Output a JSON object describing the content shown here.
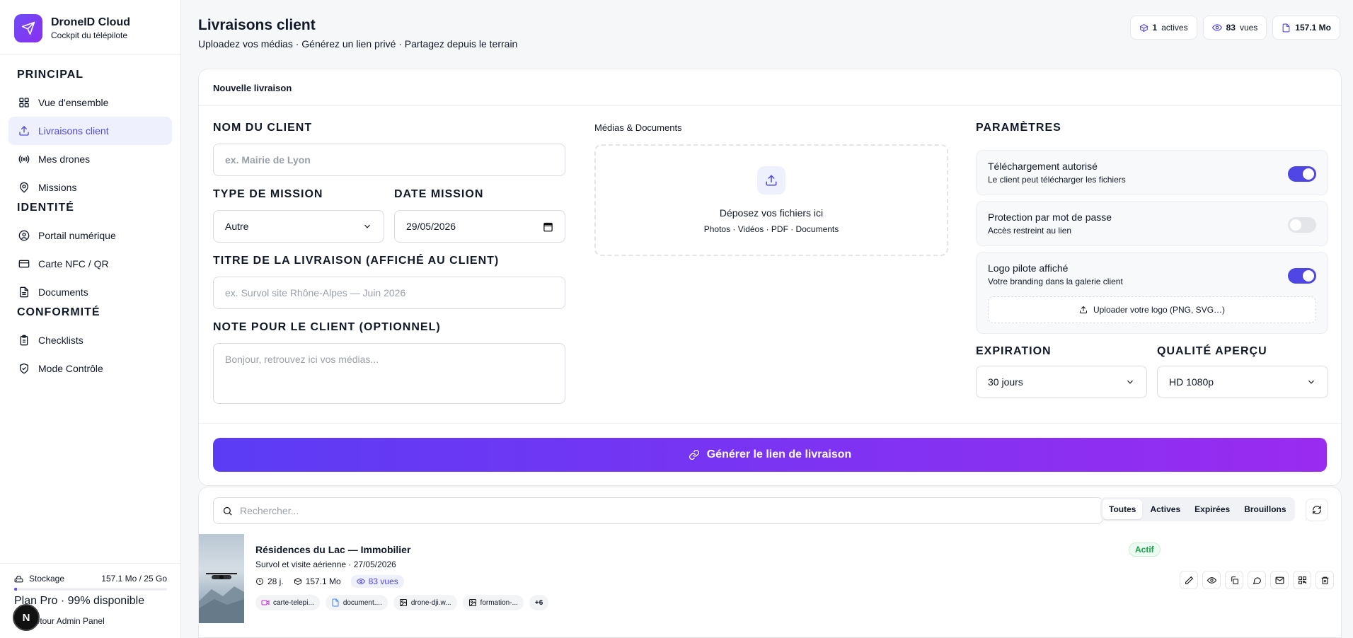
{
  "brand": {
    "name": "DroneID Cloud",
    "subtitle": "Cockpit du télépilote"
  },
  "nav": {
    "principal": {
      "title": "PRINCIPAL",
      "items": [
        {
          "label": "Vue d'ensemble",
          "icon": "grid-icon"
        },
        {
          "label": "Livraisons client",
          "icon": "upload-icon",
          "active": true
        },
        {
          "label": "Mes drones",
          "icon": "radio-icon"
        },
        {
          "label": "Missions",
          "icon": "map-pin-icon"
        }
      ]
    },
    "identite": {
      "title": "IDENTITÉ",
      "items": [
        {
          "label": "Portail numérique",
          "icon": "user-circle-icon"
        },
        {
          "label": "Carte NFC / QR",
          "icon": "card-icon"
        },
        {
          "label": "Documents",
          "icon": "file-icon"
        }
      ]
    },
    "conformite": {
      "title": "CONFORMITÉ",
      "items": [
        {
          "label": "Checklists",
          "icon": "clipboard-icon"
        },
        {
          "label": "Mode Contrôle",
          "icon": "shield-check-icon"
        }
      ]
    }
  },
  "storage": {
    "label": "Stockage",
    "usage": "157.1 Mo / 25 Go",
    "used_fraction": 0.0063,
    "plan": "Plan Pro · 99% disponible"
  },
  "back_admin": "Retour Admin Panel",
  "avatar_letter": "N",
  "header": {
    "title": "Livraisons client",
    "subtitle": "Uploadez vos médias · Générez un lien privé · Partagez depuis le terrain",
    "stats": [
      {
        "value": "1",
        "label": "actives",
        "icon": "box-icon"
      },
      {
        "value": "83",
        "label": "vues",
        "icon": "eye-icon"
      },
      {
        "value": "157.1 Mo",
        "label": "",
        "icon": "file-icon"
      }
    ]
  },
  "form": {
    "card_title": "Nouvelle livraison",
    "client_name": {
      "label": "NOM DU CLIENT",
      "placeholder": "ex. Mairie de Lyon"
    },
    "mission_type": {
      "label": "TYPE DE MISSION",
      "value": "Autre"
    },
    "mission_date": {
      "label": "DATE MISSION",
      "value": "29/05/2026"
    },
    "delivery_title": {
      "label": "TITRE DE LA LIVRAISON (AFFICHÉ AU CLIENT)",
      "placeholder": "ex. Survol site Rhône-Alpes — Juin 2026"
    },
    "note": {
      "label": "NOTE POUR LE CLIENT (OPTIONNEL)",
      "placeholder": "Bonjour, retrouvez ici vos médias..."
    },
    "media": {
      "label": "Médias & Documents",
      "drop_title": "Déposez vos fichiers ici",
      "drop_sub": "Photos · Vidéos · PDF · Documents"
    },
    "params": {
      "title": "PARAMÈTRES",
      "download": {
        "title": "Téléchargement autorisé",
        "sub": "Le client peut télécharger les fichiers",
        "on": true
      },
      "password": {
        "title": "Protection par mot de passe",
        "sub": "Accès restreint au lien",
        "on": false
      },
      "logo": {
        "title": "Logo pilote affiché",
        "sub": "Votre branding dans la galerie client",
        "on": true,
        "upload_label": "Uploader votre logo (PNG, SVG…)"
      }
    },
    "expiration": {
      "label": "EXPIRATION",
      "value": "30 jours"
    },
    "quality": {
      "label": "QUALITÉ APERÇU",
      "value": "HD 1080p"
    },
    "generate_label": "Générer le lien de livraison"
  },
  "list": {
    "search_placeholder": "Rechercher...",
    "filters": [
      "Toutes",
      "Actives",
      "Expirées",
      "Brouillons"
    ],
    "active_filter": 0,
    "rows": [
      {
        "title": "Résidences du Lac — Immobilier",
        "subtitle": "Survol et visite aérienne · 27/05/2026",
        "days": "28 j.",
        "size": "157.1 Mo",
        "views": "83 vues",
        "status": "Actif",
        "files": [
          {
            "name": "carte-telepi...",
            "icon": "video-icon"
          },
          {
            "name": "document....",
            "icon": "file-icon"
          },
          {
            "name": "drone-dji.w...",
            "icon": "image-icon"
          },
          {
            "name": "formation-...",
            "icon": "image-icon"
          }
        ],
        "more_files": "+6"
      }
    ]
  },
  "colors": {
    "accent": "#4f46e5",
    "gradient_start": "#5b3cf5",
    "gradient_end": "#9a2bf0",
    "success": "#16a34a"
  }
}
